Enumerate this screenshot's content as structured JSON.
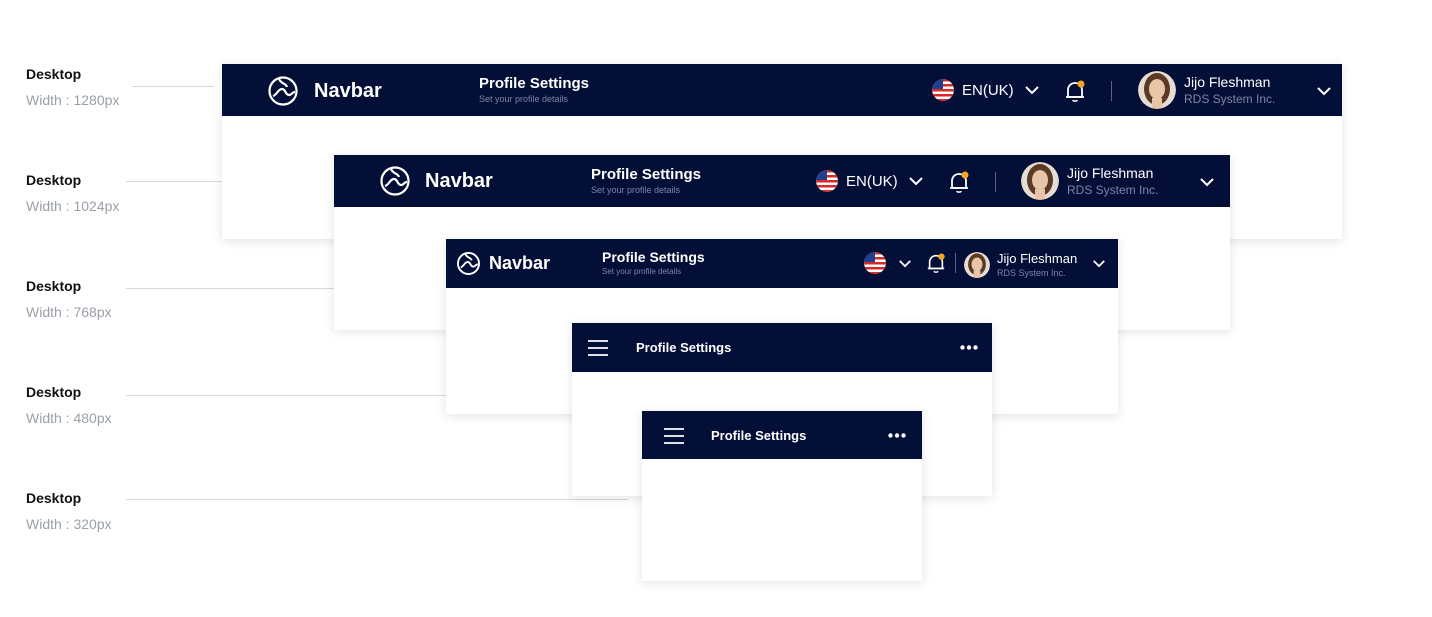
{
  "labels": [
    {
      "title": "Desktop",
      "width": "Width : 1280px"
    },
    {
      "title": "Desktop",
      "width": "Width : 1024px"
    },
    {
      "title": "Desktop",
      "width": "Width : 768px"
    },
    {
      "title": "Desktop",
      "width": "Width : 480px"
    },
    {
      "title": "Desktop",
      "width": "Width : 320px"
    }
  ],
  "navbar": {
    "brand": "Navbar",
    "page_title": "Profile Settings",
    "page_subtitle": "Set your profile details",
    "language": "EN(UK)",
    "user_name": "Jijo Fleshman",
    "company": "RDS System Inc."
  },
  "mobile": {
    "page_title": "Profile Settings"
  },
  "colors": {
    "navbar_bg": "#030f36",
    "notification_dot": "#f5a623"
  }
}
